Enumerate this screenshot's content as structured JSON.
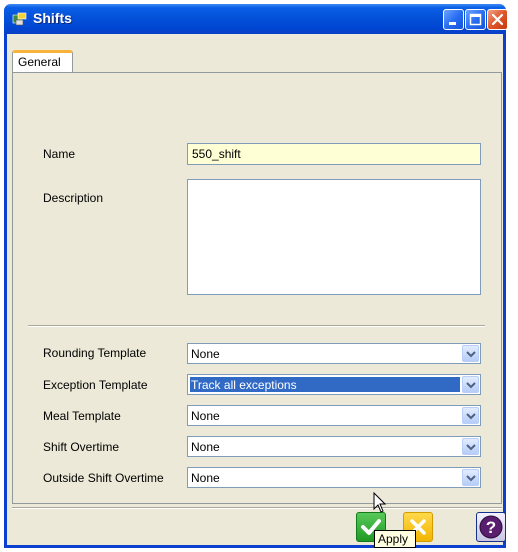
{
  "window": {
    "title": "Shifts"
  },
  "tabs": [
    {
      "label": "General",
      "active": true
    }
  ],
  "form": {
    "name_label": "Name",
    "name_value": "550_shift",
    "description_label": "Description",
    "description_value": "",
    "rounding_template_label": "Rounding Template",
    "rounding_template_value": "None",
    "exception_template_label": "Exception Template",
    "exception_template_value": "Track all exceptions",
    "meal_template_label": "Meal Template",
    "meal_template_value": "None",
    "shift_overtime_label": "Shift Overtime",
    "shift_overtime_value": "None",
    "outside_shift_overtime_label": "Outside Shift Overtime",
    "outside_shift_overtime_value": "None"
  },
  "footer": {
    "tooltip": "Apply"
  },
  "colors": {
    "titlebar": "#0552d9",
    "name_field_bg": "#ffffd5",
    "selection": "#316ac5",
    "ok_green": "#1f9a24",
    "cancel_yellow": "#f2b500"
  },
  "icons": [
    "app-icon",
    "minimize-icon",
    "maximize-icon",
    "close-icon",
    "chevron-down-icon",
    "checkmark-icon",
    "x-icon",
    "question-icon",
    "mouse-pointer-icon"
  ]
}
